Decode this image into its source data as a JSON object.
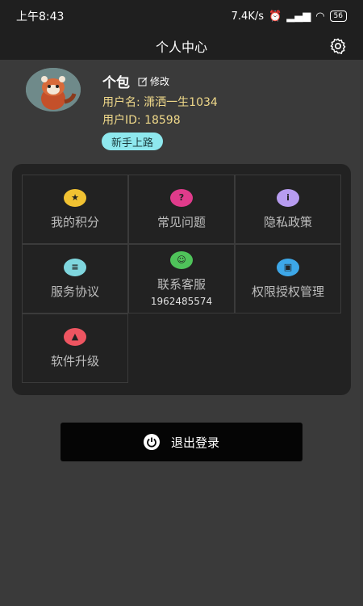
{
  "status": {
    "time": "上午8:43",
    "net_speed": "7.4K/s",
    "battery": "56"
  },
  "header": {
    "title": "个人中心"
  },
  "profile": {
    "nickname": "个包",
    "edit_label": "修改",
    "username": "用户名: 潇洒一生1034",
    "user_id": "用户ID: 18598",
    "badge": "新手上路"
  },
  "menu": [
    {
      "label": "我的积分",
      "icon": "star-icon",
      "color": "#f1c232"
    },
    {
      "label": "常见问题",
      "icon": "question-icon",
      "color": "#e03b8b"
    },
    {
      "label": "隐私政策",
      "icon": "info-icon",
      "color": "#b79cf0"
    },
    {
      "label": "服务协议",
      "icon": "document-icon",
      "color": "#7fd6de"
    },
    {
      "label": "联系客服",
      "icon": "customer-service-icon",
      "color": "#4fc35a",
      "phone": "1962485574"
    },
    {
      "label": "权限授权管理",
      "icon": "lock-icon",
      "color": "#3da7e8"
    },
    {
      "label": "软件升级",
      "icon": "rocket-icon",
      "color": "#ee5561"
    }
  ],
  "logout": {
    "label": "退出登录"
  }
}
